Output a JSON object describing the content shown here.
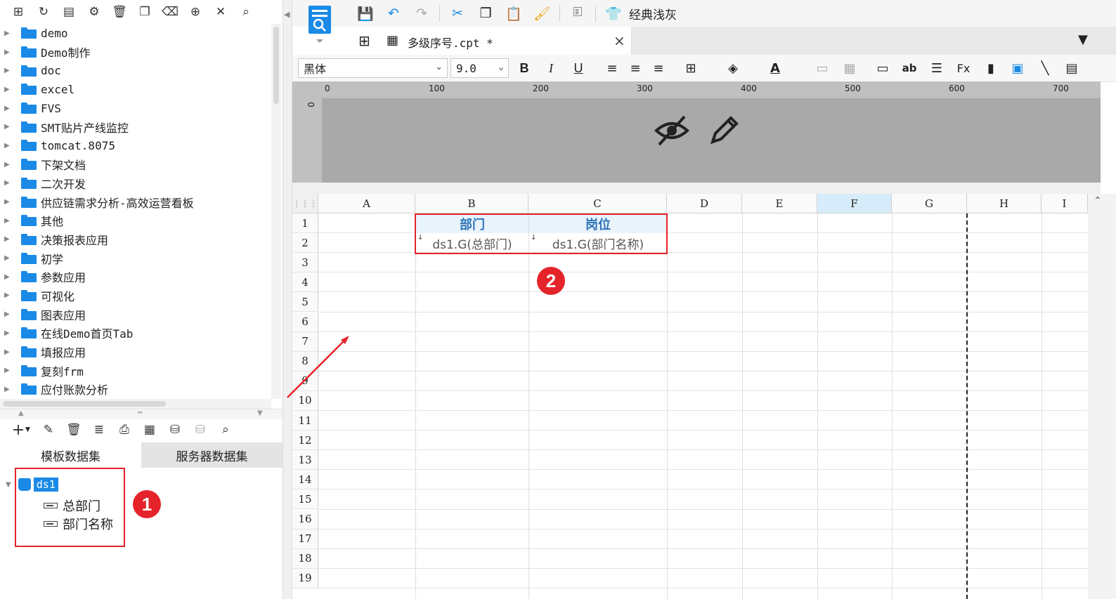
{
  "left_panel": {
    "toolbar_icons": [
      "new-folder-icon",
      "refresh-icon",
      "template-icon",
      "settings-icon",
      "delete-icon",
      "copy-icon",
      "trash-icon",
      "locate-icon",
      "collapse-icon",
      "search-icon"
    ],
    "tree_items": [
      {
        "label": "demo"
      },
      {
        "label": "Demo制作"
      },
      {
        "label": "doc"
      },
      {
        "label": "excel"
      },
      {
        "label": "FVS"
      },
      {
        "label": "SMT贴片产线监控"
      },
      {
        "label": "tomcat.8075"
      },
      {
        "label": "下架文档"
      },
      {
        "label": "二次开发"
      },
      {
        "label": "供应链需求分析-高效运营看板"
      },
      {
        "label": "其他"
      },
      {
        "label": "决策报表应用"
      },
      {
        "label": "初学"
      },
      {
        "label": "参数应用"
      },
      {
        "label": "可视化"
      },
      {
        "label": "图表应用"
      },
      {
        "label": "在线Demo首页Tab"
      },
      {
        "label": "填报应用"
      },
      {
        "label": "复刻frm"
      },
      {
        "label": "应付账款分析"
      }
    ],
    "ds_toolbar_icons": [
      "add-icon",
      "edit-icon",
      "delete-icon",
      "database-icon",
      "preview-icon",
      "dataset-edit-icon",
      "server-db-icon",
      "server-db-disabled-icon",
      "search-icon"
    ],
    "ds_tabs": {
      "template": "模板数据集",
      "server": "服务器数据集"
    },
    "dataset": {
      "name": "ds1",
      "fields": [
        "总部门",
        "部门名称"
      ]
    },
    "badge1": "1"
  },
  "toolbar": {
    "theme_label": "经典浅灰",
    "icons": [
      "save-icon",
      "undo-icon",
      "redo-icon",
      "cut-icon",
      "copy-icon",
      "paste-icon",
      "format-brush-icon",
      "text-box-icon",
      "theme-icon"
    ]
  },
  "tab": {
    "title": "多级序号.cpt *",
    "close": "×"
  },
  "format": {
    "font": "黑体",
    "size": "9.0",
    "bold": "B",
    "italic": "I",
    "underline": "U"
  },
  "ruler": {
    "labels": [
      "0",
      "100",
      "200",
      "300",
      "400",
      "500",
      "600",
      "700"
    ],
    "vertical": "0"
  },
  "sheet": {
    "columns": [
      "A",
      "B",
      "C",
      "D",
      "E",
      "F",
      "G",
      "H",
      "I"
    ],
    "selected_column": "F",
    "rows": [
      "1",
      "2",
      "3",
      "4",
      "5",
      "6",
      "7",
      "8",
      "9",
      "10",
      "11",
      "12",
      "13",
      "14",
      "15",
      "16",
      "17",
      "18",
      "19"
    ],
    "cells": {
      "B1": "部门",
      "C1": "岗位",
      "B2": "ds1.G(总部门)",
      "C2": "ds1.G(部门名称)"
    },
    "badge2": "2"
  },
  "colors": {
    "accent": "#1a8ae6",
    "highlight": "#e5232b",
    "header_text": "#2e74b8"
  }
}
